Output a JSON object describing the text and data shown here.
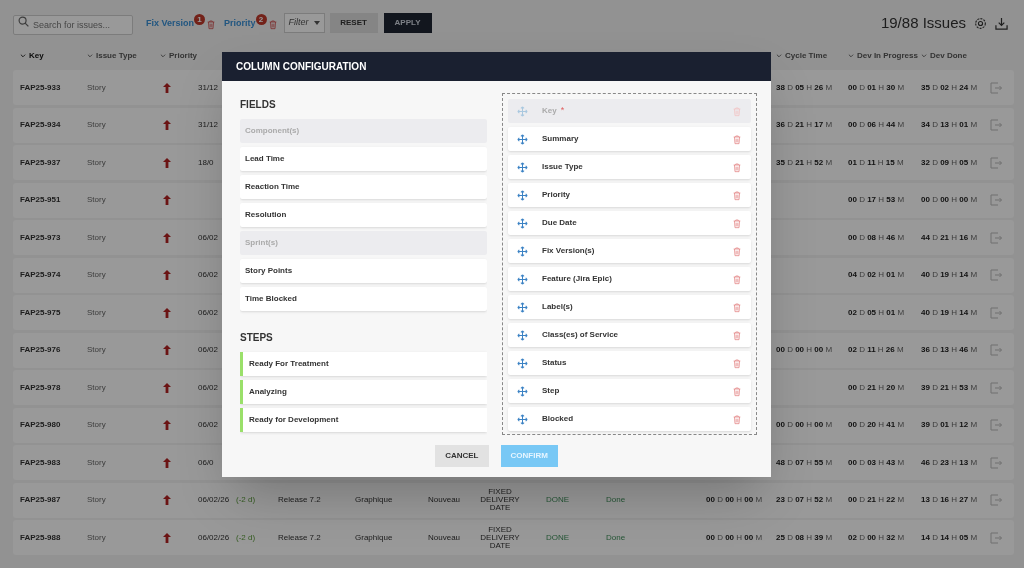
{
  "toolbar": {
    "search": {
      "placeholder": "Search for issues..."
    },
    "filters": [
      {
        "label": "Fix Version",
        "count": "1"
      },
      {
        "label": "Priority",
        "count": "2"
      }
    ],
    "filter_dropdown": {
      "placeholder": "Filter"
    },
    "buttons": [
      {
        "label": "RESET",
        "kind": "secondary"
      },
      {
        "label": "APPLY",
        "kind": "primary"
      }
    ],
    "issue_count": "19/88 Issues"
  },
  "table": {
    "columns": [
      {
        "label": "Key",
        "sorted": true
      },
      {
        "label": "Issue Type",
        "sorted": false
      },
      {
        "label": "Priority",
        "sorted": false
      },
      {
        "label": "Cycle Time",
        "sorted": false
      },
      {
        "label": "Dev In Progress",
        "sorted": false
      },
      {
        "label": "Dev Done",
        "sorted": false
      }
    ],
    "rows": [
      {
        "key": "FAP25-933",
        "issue_type": "Story",
        "high_priority": true,
        "due_date": "31/12",
        "cycle_time": "38 D 05 H 26 M",
        "dev_in_progress": "00 D 01 H 30 M",
        "dev_done": "35 D 02 H 24 M"
      },
      {
        "key": "FAP25-934",
        "issue_type": "Story",
        "high_priority": true,
        "due_date": "31/12",
        "cycle_time": "36 D 21 H 17 M",
        "dev_in_progress": "00 D 06 H 44 M",
        "dev_done": "34 D 13 H 01 M"
      },
      {
        "key": "FAP25-937",
        "issue_type": "Story",
        "high_priority": true,
        "due_date": "18/0",
        "cycle_time": "35 D 21 H 52 M",
        "dev_in_progress": "01 D 11 H 15 M",
        "dev_done": "32 D 09 H 05 M"
      },
      {
        "key": "FAP25-951",
        "issue_type": "Story",
        "high_priority": true,
        "dev_in_progress": "00 D 17 H 53 M",
        "dev_done": "00 D 00 H 00 M"
      },
      {
        "key": "FAP25-973",
        "issue_type": "Story",
        "high_priority": true,
        "due_date": "06/02",
        "dev_in_progress": "00 D 08 H 46 M",
        "dev_done": "44 D 21 H 16 M"
      },
      {
        "key": "FAP25-974",
        "issue_type": "Story",
        "high_priority": true,
        "due_date": "06/02",
        "dev_in_progress": "04 D 02 H 01 M",
        "dev_done": "40 D 19 H 14 M"
      },
      {
        "key": "FAP25-975",
        "issue_type": "Story",
        "high_priority": true,
        "due_date": "06/02",
        "dev_in_progress": "02 D 05 H 01 M",
        "dev_done": "40 D 19 H 14 M"
      },
      {
        "key": "FAP25-976",
        "issue_type": "Story",
        "high_priority": true,
        "due_date": "06/02",
        "cycle_time": "00 D 00 H 00 M",
        "dev_in_progress": "02 D 11 H 26 M",
        "dev_done": "36 D 13 H 46 M"
      },
      {
        "key": "FAP25-978",
        "issue_type": "Story",
        "high_priority": true,
        "due_date": "06/02",
        "dev_in_progress": "00 D 21 H 20 M",
        "dev_done": "39 D 21 H 53 M"
      },
      {
        "key": "FAP25-980",
        "issue_type": "Story",
        "high_priority": true,
        "due_date": "06/02",
        "cycle_time": "00 D 00 H 00 M",
        "dev_in_progress": "00 D 20 H 41 M",
        "dev_done": "39 D 01 H 12 M"
      },
      {
        "key": "FAP25-983",
        "issue_type": "Story",
        "high_priority": true,
        "due_date": "06/0",
        "cycle_time": "48 D 07 H 55 M",
        "dev_in_progress": "00 D 03 H 43 M",
        "dev_done": "46 D 23 H 13 M"
      },
      {
        "key": "FAP25-987",
        "issue_type": "Story",
        "high_priority": true,
        "due_date": "06/02/26",
        "due_delta": "(-2 d)",
        "fix_version": "Release 7.2",
        "feature": "Graphique",
        "status": "Nouveau",
        "class_of_service": "FIXED DELIVERY DATE",
        "step": "DONE",
        "step_status": "Done",
        "lead_time": "00 D 00 H 00 M",
        "cycle_time": "23 D 07 H 52 M",
        "dev_in_progress": "00 D 21 H 22 M",
        "dev_done": "13 D 16 H 27 M"
      },
      {
        "key": "FAP25-988",
        "issue_type": "Story",
        "high_priority": true,
        "due_date": "06/02/26",
        "due_delta": "(-2 d)",
        "fix_version": "Release 7.2",
        "feature": "Graphique",
        "status": "Nouveau",
        "class_of_service": "FIXED DELIVERY DATE",
        "step": "DONE",
        "step_status": "Done",
        "lead_time": "00 D 00 H 00 M",
        "cycle_time": "25 D 08 H 39 M",
        "dev_in_progress": "02 D 00 H 32 M",
        "dev_done": "14 D 14 H 05 M"
      }
    ]
  },
  "modal": {
    "title": "COLUMN CONFIGURATION",
    "fields_heading": "FIELDS",
    "fields": [
      {
        "label": "Component(s)",
        "disabled": true
      },
      {
        "label": "Lead Time",
        "disabled": false
      },
      {
        "label": "Reaction Time",
        "disabled": false
      },
      {
        "label": "Resolution",
        "disabled": false
      },
      {
        "label": "Sprint(s)",
        "disabled": true
      },
      {
        "label": "Story Points",
        "disabled": false
      },
      {
        "label": "Time Blocked",
        "disabled": false
      }
    ],
    "steps_heading": "STEPS",
    "steps": [
      {
        "label": "Ready For Treatment"
      },
      {
        "label": "Analyzing"
      },
      {
        "label": "Ready for Development"
      }
    ],
    "selected_columns": [
      {
        "label": "Key",
        "disabled": true,
        "required_mark": "*"
      },
      {
        "label": "Summary",
        "disabled": false
      },
      {
        "label": "Issue Type",
        "disabled": false
      },
      {
        "label": "Priority",
        "disabled": false
      },
      {
        "label": "Due Date",
        "disabled": false
      },
      {
        "label": "Fix Version(s)",
        "disabled": false
      },
      {
        "label": "Feature (Jira Epic)",
        "disabled": false
      },
      {
        "label": "Label(s)",
        "disabled": false
      },
      {
        "label": "Class(es) of Service",
        "disabled": false
      },
      {
        "label": "Status",
        "disabled": false
      },
      {
        "label": "Step",
        "disabled": false
      },
      {
        "label": "Blocked",
        "disabled": false
      }
    ],
    "buttons": [
      {
        "label": "CANCEL",
        "kind": "secondary",
        "disabled": false
      },
      {
        "label": "CONFIRM",
        "kind": "primary",
        "disabled": true
      }
    ]
  }
}
